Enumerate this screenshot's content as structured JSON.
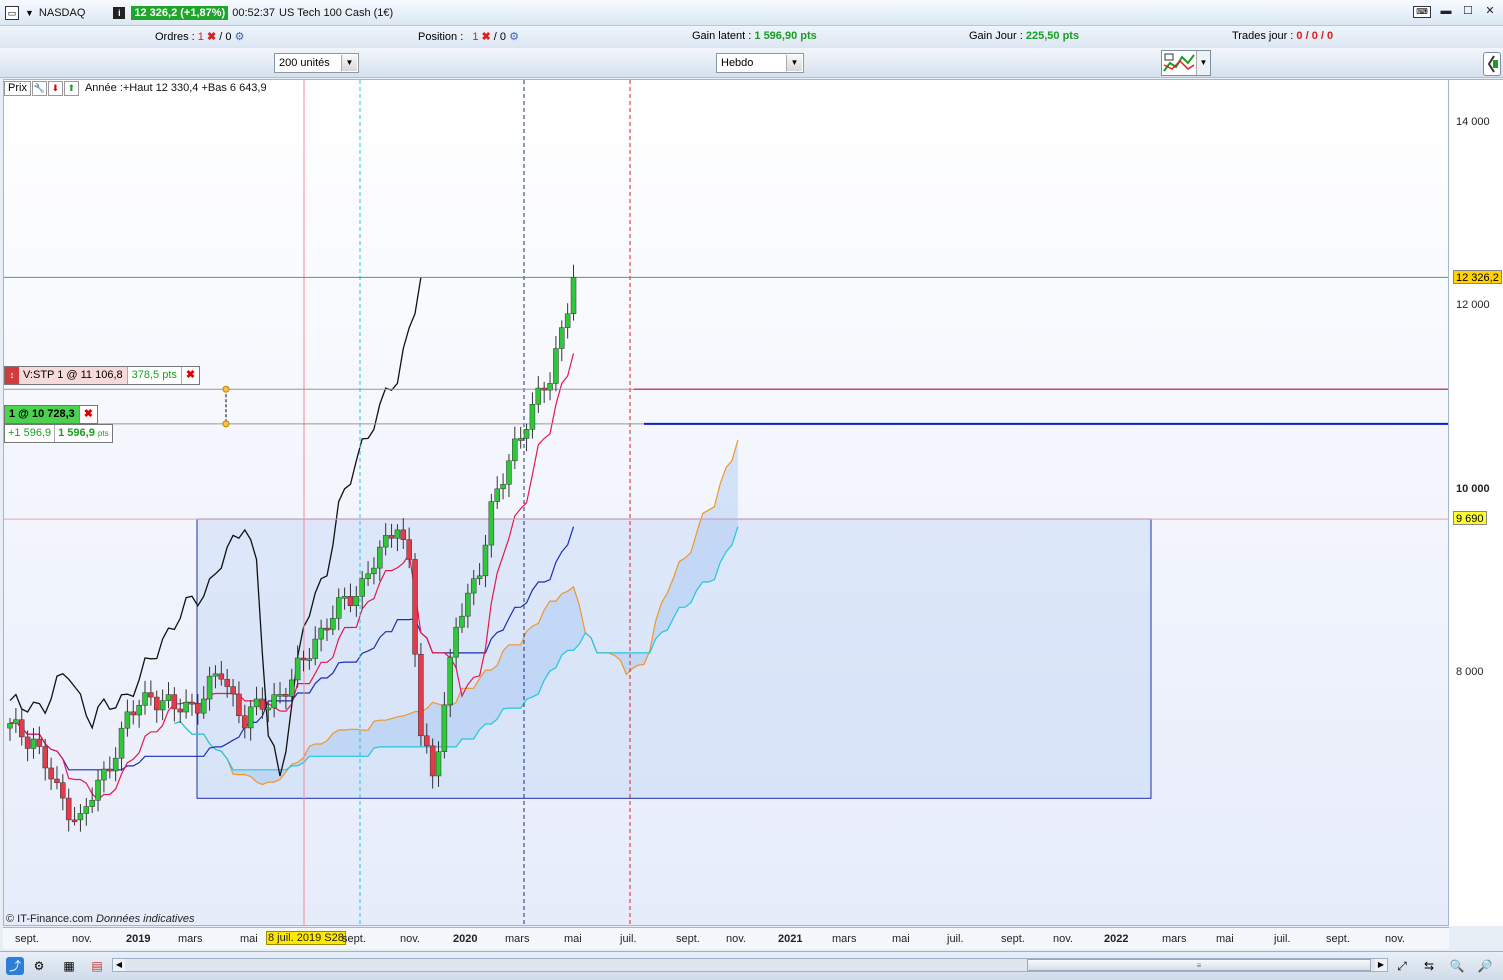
{
  "window": {
    "symbol": "NASDAQ",
    "price_badge": "12 326,2 (+1,87%)",
    "time": "00:52:37",
    "instrument": "US Tech 100 Cash (1€)"
  },
  "info": {
    "ordres_label": "Ordres :",
    "ordres_count": "1",
    "ordres_sep": "/ 0",
    "position_label": "Position :",
    "position_count": "1",
    "position_sep": "/ 0",
    "gain_latent_label": "Gain latent :",
    "gain_latent_value": "1 596,90 pts",
    "gain_jour_label": "Gain Jour :",
    "gain_jour_value": "225,50 pts",
    "trades_label": "Trades jour :",
    "trades_value": "0 / 0 / 0"
  },
  "toolbar": {
    "units": "200 unités",
    "period": "Hebdo"
  },
  "legend": {
    "prix": "Prix",
    "annotation": "Année :+Haut 12 330,4 +Bas 6 643,9"
  },
  "orders": {
    "stop_label": "V:STP  1 @ 11 106,8",
    "stop_pts": "378,5 pts",
    "position_label": "1 @ 10 728,3",
    "pnl_eur": "+1 596,9",
    "pnl_pts": "1 596,9",
    "pnl_pts_unit": "pts"
  },
  "yaxis": {
    "ticks": [
      {
        "label": "14 000",
        "value": 14000
      },
      {
        "label": "12 000",
        "value": 12000
      },
      {
        "label": "10 000",
        "value": 10000
      },
      {
        "label": "8 000",
        "value": 8000
      }
    ],
    "current_label": "12 326,2",
    "level_label": "9 690"
  },
  "xaxis": {
    "labels": [
      "sept.",
      "nov.",
      "2019",
      "mars",
      "mai",
      "8 juil. 2019 S28",
      "sept.",
      "nov.",
      "2020",
      "mars",
      "mai",
      "juil.",
      "sept.",
      "nov.",
      "2021",
      "mars",
      "mai",
      "juil.",
      "sept.",
      "nov.",
      "2022",
      "mars",
      "mai",
      "juil.",
      "sept.",
      "nov."
    ]
  },
  "footer": {
    "copyright": "© IT-Finance.com",
    "disclaimer": "Données indicatives"
  },
  "colors": {
    "up": "#2ec83a",
    "down": "#e23b4a",
    "tenkan": "#e8174e",
    "kijun": "#1b2fb8",
    "senkou_a": "#f0952a",
    "senkou_b": "#21c6e0",
    "chikou": "#111111"
  },
  "chart_data": {
    "type": "candlestick",
    "timeframe": "Hebdo",
    "ylim": [
      5500,
      14800
    ],
    "current_price": 12326.2,
    "stop_level": 11106.8,
    "position_level": 10728.3,
    "level_line": 9690,
    "year_high": 12330.4,
    "year_low": 6643.9,
    "period_labels": [
      "sept.",
      "nov.",
      "2019",
      "mars",
      "mai",
      "juil.",
      "sept.",
      "nov.",
      "2020",
      "mars",
      "mai",
      "juil.",
      "sept."
    ],
    "anchor_points": [
      [
        0,
        7400
      ],
      [
        4,
        7300
      ],
      [
        8,
        6700
      ],
      [
        12,
        6400
      ],
      [
        16,
        6900
      ],
      [
        20,
        7500
      ],
      [
        24,
        7800
      ],
      [
        28,
        7600
      ],
      [
        32,
        7700
      ],
      [
        36,
        8000
      ],
      [
        40,
        7500
      ],
      [
        44,
        7700
      ],
      [
        48,
        7900
      ],
      [
        52,
        8400
      ],
      [
        56,
        8700
      ],
      [
        60,
        9000
      ],
      [
        64,
        9400
      ],
      [
        66,
        9700
      ],
      [
        68,
        9200
      ],
      [
        70,
        7300
      ],
      [
        72,
        6900
      ],
      [
        74,
        7700
      ],
      [
        76,
        8500
      ],
      [
        78,
        8800
      ],
      [
        80,
        9200
      ],
      [
        82,
        9800
      ],
      [
        84,
        10100
      ],
      [
        86,
        10500
      ],
      [
        88,
        10800
      ],
      [
        90,
        11000
      ],
      [
        92,
        11200
      ],
      [
        94,
        11800
      ],
      [
        96,
        12326
      ]
    ]
  }
}
